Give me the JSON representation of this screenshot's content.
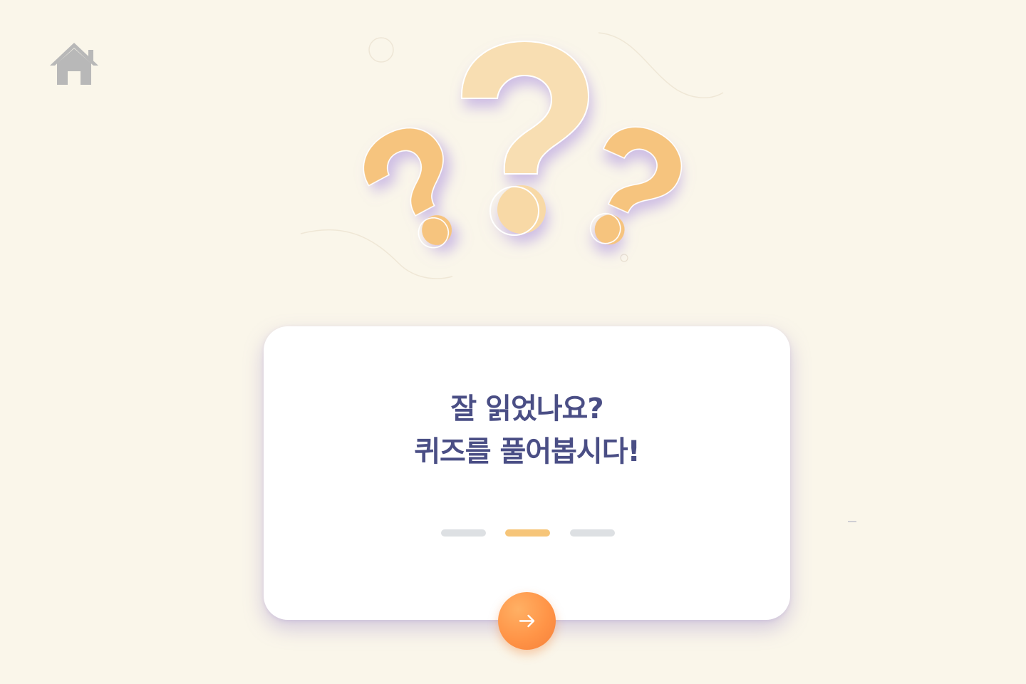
{
  "home": {
    "icon": "home-icon"
  },
  "illustration": {
    "icon": "question-marks-icon"
  },
  "card": {
    "heading_line1": "잘 읽었나요?",
    "heading_line2": "퀴즈를 풀어봅시다!"
  },
  "pager": {
    "pages": 3,
    "active_index": 1
  },
  "next_button": {
    "icon": "arrow-right-icon"
  },
  "colors": {
    "background": "#faf6ea",
    "heading": "#4a4e85",
    "accent_orange": "#ff9447",
    "pager_active": "#f6c579",
    "pager_inactive": "#dde0e3",
    "home_icon": "#b8b8b8"
  }
}
